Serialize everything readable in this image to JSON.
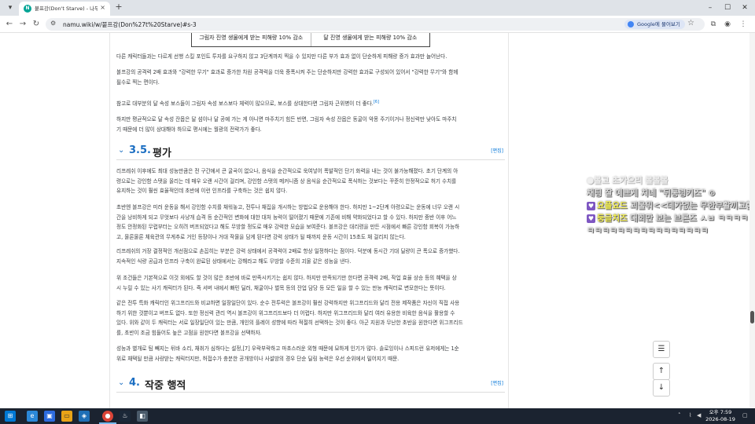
{
  "browser": {
    "tab_title": "붙프강(Don't Starve) - 나무위키",
    "tab_close": "×",
    "new_tab": "+",
    "url": "namu.wiki/w/붙프강(Don%27t%20Starve)#s-3",
    "google_chip": "Google에 물어보기",
    "window_min": "–",
    "window_max": "☐",
    "window_close": "✕"
  },
  "article": {
    "table_cells": [
      "그림자 진영 생물에게 받는 피해량 10% 감소",
      "달 진영 생물에게 받는 피해량 10% 감소"
    ],
    "para1": [
      "다른 캐릭터들과는 다르게 선행 스킬 포인트 투자를 요구하지 않고 3단계까지 찍을 수 있지만 다른 부가 효과 없이 단순하게 피해량 증가 효과만 늘어난다."
    ],
    "para2": [
      "볼프강의 공격력 2배 효과와 \"강력한 무기\" 효과로 증가한 차원 공격력을 더욱 중폭시켜 주는 단순하지만 강력한 효과로 구성되어 있어서 \"강력한 무기\"와 함께",
      "필수로 찍는 편이다."
    ],
    "para3": [
      "참고로 대부분의 달 속성 보스들이 그림자 속성 보스보다 체력이 많으므로, 보스를 상대한다면 그림자 근위병이 더 좋다."
    ],
    "para3_footnote": "[6]",
    "para4": [
      "하지만 평균적으로 달 속성 잔몹은 달 섬이나 달 공예 가는 게 아니면 마주치기 힘든 반면, 그림자 속성 잔몹은 동굴이 악몽 주기이거나 정신력만 낮아도 마주치",
      "기 때문에 더 많이 상대해야 하므로 평시에는 월광의 전략가가 좋다."
    ],
    "section_35": {
      "num": "3.5.",
      "title": "평가",
      "edit": "[편집]"
    },
    "para5": [
      "리프레쉬 이후에도 최대 성능만큼은 전 구간에서 큰 굴곡이 없으나, 음식을 순간적으로 욱여넣어 폭발적인 단기 화력을 내는 것이 불가능해졌다. 초기 단계의 아",
      "령으로는 강인함 스탯을 올리는 데 매우 오랜 시간이 걸리며, 강인함 스탯의 메커니즘 상 음식을 순간적으로 폭식하는 것보다는 꾸준히 안정적으로 허기 수치를",
      "유지하는 것이 훨씬 효율적인데 초반에 이런 인프라를 구축하는 것은 쉽지 않다."
    ],
    "para6": [
      "초반엔 볼프강은 미러 운동을 해서 강인함 수치를 채워놓고, 전투나 채집을 개시하는 방법으로 운용해야 한다. 하지만 1~2단계 아령으로는 운동에 너무 오랜 시",
      "간을 낭비하게 되고 무엇보다 사냥개 습격 등 순간적인 변화에 대한 대처 능력이 떨어졌기 때문에 기존에 비해 약화되었다고 할 수 있다. 하지만 중반 이후 어느",
      "정도 안정화된 무렵부터는 오히려 버프되었다고 해도 무방할 정도로 매우 강력한 모습을 보여준다. 볼프강은 대리령을 만든 시점에서 빠른 강인함 회복이 가능하",
      "고, 물론물론 체육관의 무게추로 거인 등장이나 거대 작물을 담게 된다면 강력 상태가 될 때까지 운동 시간이 15초도 채 걸리지 않는다."
    ],
    "para7": [
      "리프레쉬의 거장 결정적인 개선점으로 손꼽히는 부분은 강력 상태에서 공격력이 2배로 항상 일정하다는 점이다. 덕분에 동시간 기대 딜량이 큰 폭으로 증가했다.",
      "지속적인 식량 공급과 인프라 구축이 완료된 상태에서는 강해라고 해도 무방할 수준의 괴물 같은 성능을 낸다."
    ],
    "para8": [
      "위 조건들은 기본적으로 이것 외에도 할 것이 많은 초반에 바로 만족시키기는 쉽지 않다. 하지만 만족되기만 한다면 공격력 2배, 작업 효율 상승 등의 혜택을 상",
      "시 누릴 수 있는 사기 캐릭터가 된다. 즉 서버 내에서 빠민 딜러, 채굴이나 벌목 등의 잔업 담당 등 모든 일을 할 수 있는 만능 캐릭터로 변모한다는 뜻이다."
    ],
    "para9": [
      "같은 전투 특화 캐릭터인 위그프리드와 비교하면 일장일단이 있다. 순수 전투력은 볼프강이 훨씬 강력하지만 위그프리드와 달리 전용 제작품은 자신이 직접 사용",
      "하기 위한 것뿐이고 버프도 없다. 또한 정신력 관리 역시 볼프강이 위그프리드보다 더 어렵다. 하지만 위그프리드와 달리 여러 유용한 비육한 음식을 활용할 수",
      "있다. 위와 같이 두 캐릭터는 서로 일장일단이 있는 만큼, 개인의 플레이 성향에 따라 적절히 선택하는 것이 좋다. 아군 지원과 무난한 초반을 원한다면 위그프리드",
      "를, 초반이 조금 힘들어도 높은 고점을 원한다면 볼프강을 선택하자."
    ],
    "para10": [
      "성능과 별개로 팀 빼지는 뒤바 소리, 채취가 심하다는 설정,[7] 우락부락하고 마초스러운 외형 때문에 묘하게 인기가 많다. 솔로잉이나 스피드런 유저에게는 1순",
      "위로 채택될 만큼 사랑받는 캐릭터지만, 허접수가 충분한 공개방이나 사설방의 경우 단순 딜링 능력은 우선 순위에서 밀어지기 때문."
    ],
    "section_4": {
      "num": "4.",
      "title": "작중 행적",
      "edit": "[편집]"
    }
  },
  "chat": {
    "msg0": "●볼고 초가으리 볼볼볼",
    "msg1": "채팅 잘 예쁘게 치네 \"뒤통령키즈\" ⊙",
    "msg2_user": "요플요드",
    "msg2_text": "괴물뭐<<데가없는 무한부활끼고함",
    "msg3_user": "둥글치즈",
    "msg3_text": "대회만 보는 브론즈 ㅅㅂ ㅋㅋㅋㅋㅋㅋㅋㅋㅋㅋㅋㅋㅋㅋㅋㅋㅋㅋㅋㅋ"
  },
  "fab": {
    "toc": "☰",
    "up": "↑",
    "down": "↓"
  },
  "taskbar": {
    "time": "오후 7:59",
    "date": "2026-08-19"
  }
}
